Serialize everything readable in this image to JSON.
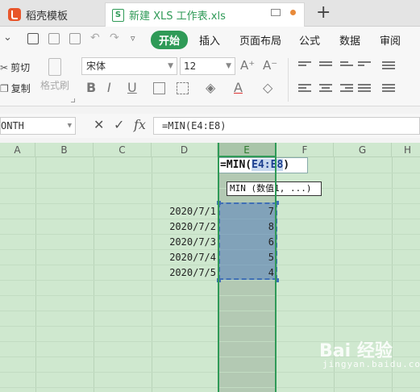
{
  "tabs": {
    "templates_label": "稻壳模板",
    "file_label": "新建 XLS 工作表.xls",
    "new_tab": "+"
  },
  "menu": {
    "items": [
      "开始",
      "插入",
      "页面布局",
      "公式",
      "数据",
      "审阅"
    ]
  },
  "ribbon": {
    "cut_label": "剪切",
    "copy_label": "复制",
    "painter_label": "格式刷",
    "font_name": "宋体",
    "font_size": "12"
  },
  "formula_bar": {
    "name_box": "ONTH",
    "formula": "=MIN(E4:E8)"
  },
  "grid": {
    "columns": [
      "A",
      "B",
      "C",
      "D",
      "E",
      "F",
      "G",
      "H"
    ],
    "active_column": "E",
    "edit_cell": {
      "prefix": "=MIN(",
      "ref": "E4:E8",
      "suffix": ")"
    },
    "tooltip": "MIN (数值1, ...)",
    "rows": [
      {
        "date": "2020/7/1",
        "value": "7"
      },
      {
        "date": "2020/7/2",
        "value": "8"
      },
      {
        "date": "2020/7/3",
        "value": "6"
      },
      {
        "date": "2020/7/4",
        "value": "5"
      },
      {
        "date": "2020/7/5",
        "value": "4"
      }
    ]
  },
  "watermark": {
    "main": "Bai  经验",
    "sub": "jingyan.baidu.com"
  },
  "colors": {
    "accent": "#2f9a57",
    "grid_bg": "#cfe8cf",
    "selection": "#3f6fb5",
    "wps": "#e8552a"
  }
}
